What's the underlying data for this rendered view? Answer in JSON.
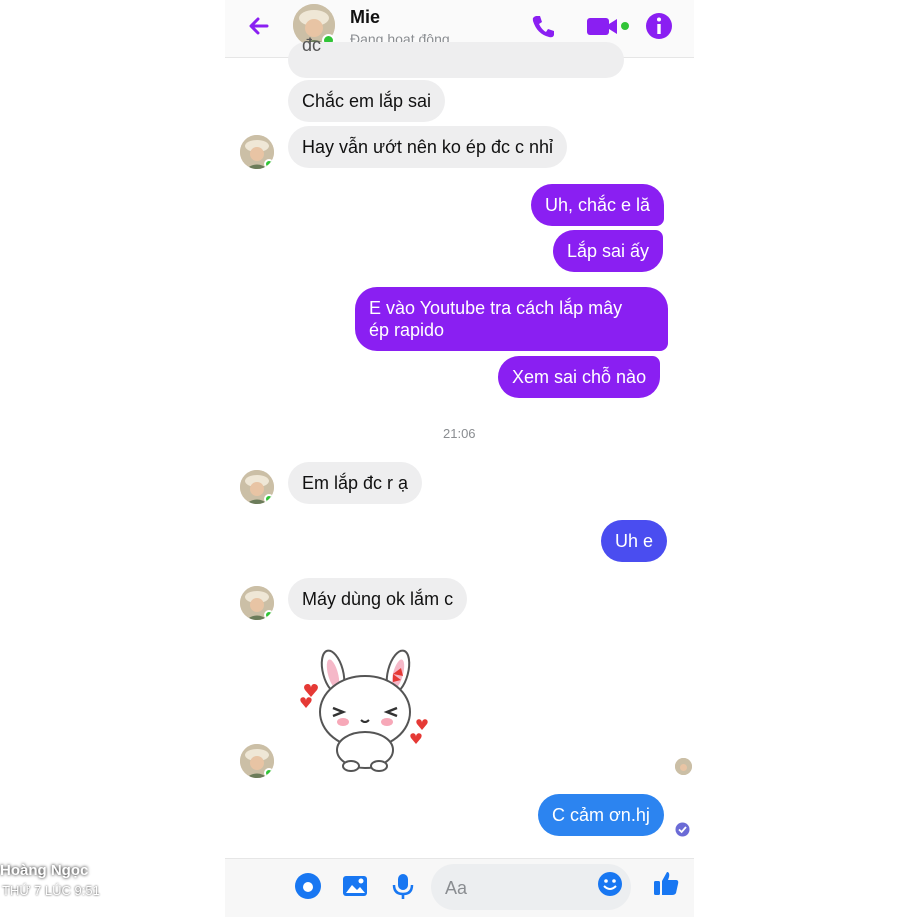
{
  "header": {
    "contact_name": "Mie",
    "status": "Đang hoạt động",
    "icons": [
      "back-arrow-icon",
      "phone-icon",
      "video-camera-icon",
      "info-icon"
    ]
  },
  "messages": [
    {
      "from": "them",
      "text": "đc"
    },
    {
      "from": "them",
      "text": "Chắc em lắp sai"
    },
    {
      "from": "them",
      "text": "Hay vẫn ướt nên ko ép đc c nhỉ"
    },
    {
      "from": "me",
      "text": "Uh, chắc e lă"
    },
    {
      "from": "me",
      "text": "Lắp sai ấy"
    },
    {
      "from": "me",
      "text": "E vào Youtube tra cách lắp mây ép rapido"
    },
    {
      "from": "me",
      "text": "Xem sai chỗ nào"
    },
    {
      "from": "them",
      "text": "Em lắp đc r ạ"
    },
    {
      "from": "me",
      "text": "Uh e"
    },
    {
      "from": "them",
      "text": "Máy dùng ok lắm c"
    },
    {
      "from": "them",
      "sticker": "bunny-hearts-sticker"
    },
    {
      "from": "me",
      "text": "C cảm ơn.hj"
    }
  ],
  "msg_lines": {
    "purple3_line1": "E vào Youtube tra cách lắp mây",
    "purple3_line2": "ép rapido"
  },
  "timestamp": "21:06",
  "composer": {
    "placeholder": "Aa",
    "icons": [
      "camera-icon",
      "image-icon",
      "microphone-icon",
      "emoji-icon",
      "thumbs-up-icon"
    ]
  },
  "overlay": {
    "name": "Hoàng Ngọc",
    "sub": "THỨ 7 LÚC 9:51"
  },
  "colors": {
    "accent": "#8a1ff2",
    "outgoing_purple": "#8a1ff2",
    "outgoing_blue": "#4a4df0",
    "incoming": "#eeeeef",
    "online": "#31c437"
  }
}
